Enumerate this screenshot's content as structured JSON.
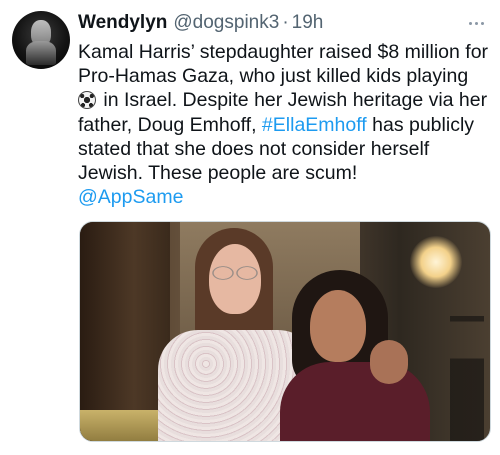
{
  "tweet": {
    "author_name": "Wendylyn",
    "author_handle": "@dogspink3",
    "separator": "·",
    "timestamp": "19h",
    "text_part1": "Kamal Harris’ stepdaughter raised $8 million for Pro-Hamas Gaza, who just killed kids playing ",
    "emoji_icon": "soccer-ball-icon",
    "text_part2": " in Israel. Despite her Jewish heritage via her father, Doug Emhoff, ",
    "hashtag": "#EllaEmhoff",
    "text_part3": " has publicly stated that she does not consider herself Jewish. These people are scum!",
    "mention": "@AppSame"
  },
  "colors": {
    "text": "#0f1419",
    "secondary": "#536471",
    "link": "#1d9bf0"
  }
}
